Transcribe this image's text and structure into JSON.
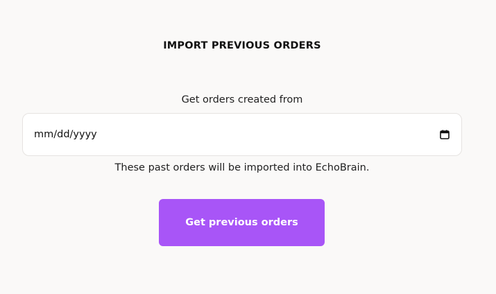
{
  "header": {
    "title": "IMPORT PREVIOUS ORDERS"
  },
  "form": {
    "date_label": "Get orders created from",
    "date_placeholder": "mm/dd/yyyy",
    "date_icon": "calendar-icon",
    "helper_text": "These past orders will be imported into EchoBrain.",
    "submit_label": "Get previous orders"
  },
  "colors": {
    "background": "#faf9f8",
    "accent": "#a855f7",
    "input_border": "#e6e3e1"
  }
}
